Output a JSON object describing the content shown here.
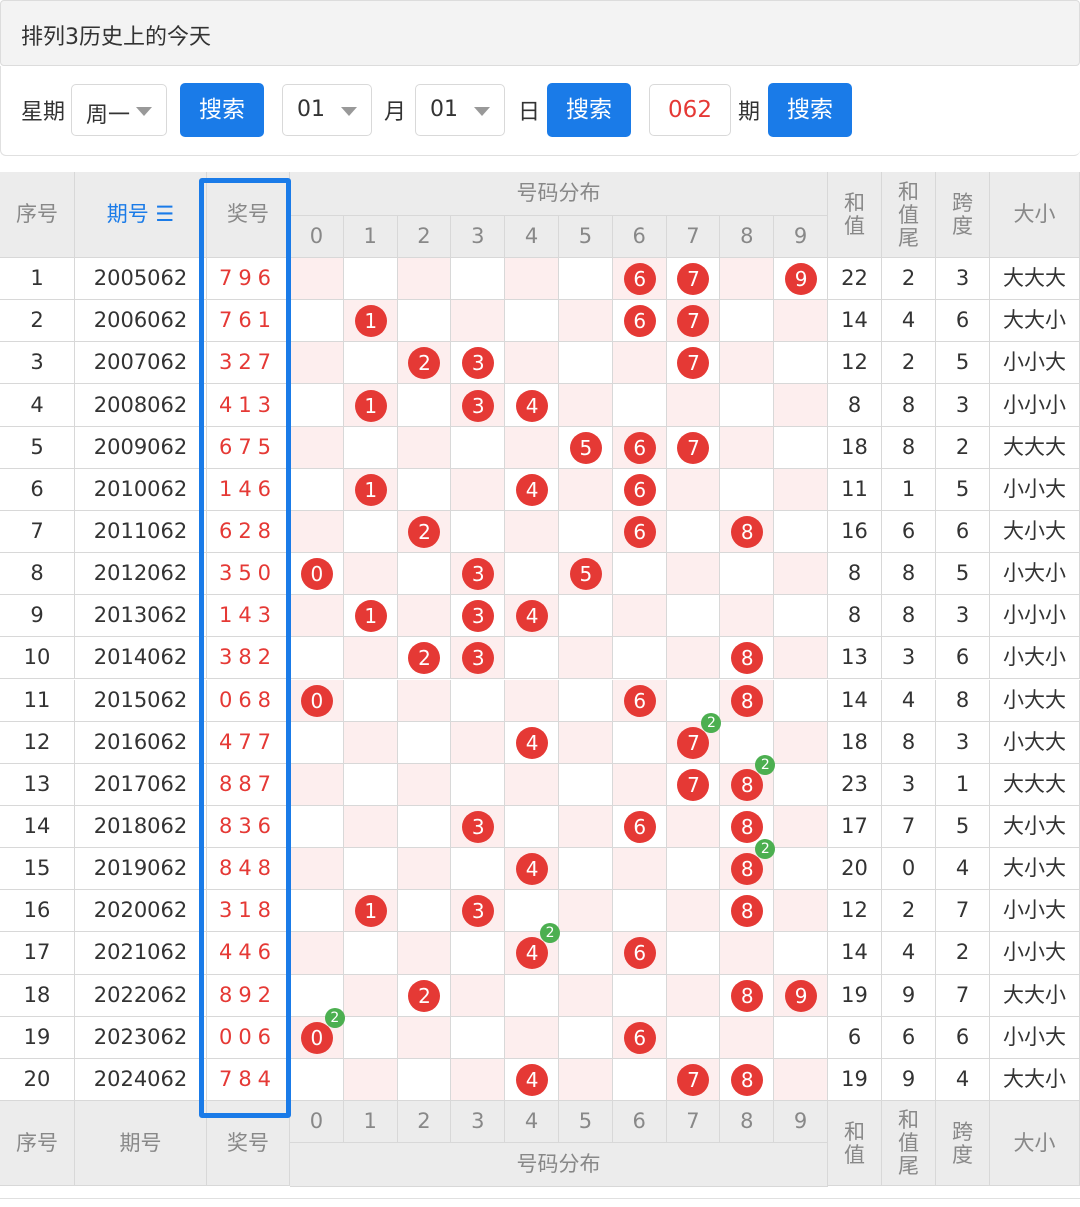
{
  "title": "排列3历史上的今天",
  "search": {
    "week_label": "星期",
    "week_value": "周一",
    "month_value": "01",
    "month_label": "月",
    "day_value": "01",
    "day_label": "日",
    "period_value": "062",
    "period_label": "期",
    "search_button": "搜索"
  },
  "table": {
    "headers": {
      "index": "序号",
      "period": "期号",
      "award": "奖号",
      "distribution": "号码分布",
      "sum": "和值",
      "sum_tail": "和值尾",
      "span": "跨度",
      "size": "大小"
    },
    "digits": [
      "0",
      "1",
      "2",
      "3",
      "4",
      "5",
      "6",
      "7",
      "8",
      "9"
    ],
    "rows": [
      {
        "idx": "1",
        "period": "2005062",
        "award": "796",
        "nums": [
          7,
          9,
          6
        ],
        "dup": null,
        "sum": "22",
        "tail": "2",
        "span": "3",
        "size": "大大大"
      },
      {
        "idx": "2",
        "period": "2006062",
        "award": "761",
        "nums": [
          7,
          6,
          1
        ],
        "dup": null,
        "sum": "14",
        "tail": "4",
        "span": "6",
        "size": "大大小"
      },
      {
        "idx": "3",
        "period": "2007062",
        "award": "327",
        "nums": [
          3,
          2,
          7
        ],
        "dup": null,
        "sum": "12",
        "tail": "2",
        "span": "5",
        "size": "小小大"
      },
      {
        "idx": "4",
        "period": "2008062",
        "award": "413",
        "nums": [
          4,
          1,
          3
        ],
        "dup": null,
        "sum": "8",
        "tail": "8",
        "span": "3",
        "size": "小小小"
      },
      {
        "idx": "5",
        "period": "2009062",
        "award": "675",
        "nums": [
          6,
          7,
          5
        ],
        "dup": null,
        "sum": "18",
        "tail": "8",
        "span": "2",
        "size": "大大大"
      },
      {
        "idx": "6",
        "period": "2010062",
        "award": "146",
        "nums": [
          1,
          4,
          6
        ],
        "dup": null,
        "sum": "11",
        "tail": "1",
        "span": "5",
        "size": "小小大"
      },
      {
        "idx": "7",
        "period": "2011062",
        "award": "628",
        "nums": [
          6,
          2,
          8
        ],
        "dup": null,
        "sum": "16",
        "tail": "6",
        "span": "6",
        "size": "大小大"
      },
      {
        "idx": "8",
        "period": "2012062",
        "award": "350",
        "nums": [
          3,
          5,
          0
        ],
        "dup": null,
        "sum": "8",
        "tail": "8",
        "span": "5",
        "size": "小大小"
      },
      {
        "idx": "9",
        "period": "2013062",
        "award": "143",
        "nums": [
          1,
          4,
          3
        ],
        "dup": null,
        "sum": "8",
        "tail": "8",
        "span": "3",
        "size": "小小小"
      },
      {
        "idx": "10",
        "period": "2014062",
        "award": "382",
        "nums": [
          3,
          8,
          2
        ],
        "dup": null,
        "sum": "13",
        "tail": "3",
        "span": "6",
        "size": "小大小"
      },
      {
        "idx": "11",
        "period": "2015062",
        "award": "068",
        "nums": [
          0,
          6,
          8
        ],
        "dup": null,
        "sum": "14",
        "tail": "4",
        "span": "8",
        "size": "小大大"
      },
      {
        "idx": "12",
        "period": "2016062",
        "award": "477",
        "nums": [
          4,
          7
        ],
        "dup": 7,
        "sum": "18",
        "tail": "8",
        "span": "3",
        "size": "小大大"
      },
      {
        "idx": "13",
        "period": "2017062",
        "award": "887",
        "nums": [
          8,
          7
        ],
        "dup": 8,
        "sum": "23",
        "tail": "3",
        "span": "1",
        "size": "大大大"
      },
      {
        "idx": "14",
        "period": "2018062",
        "award": "836",
        "nums": [
          8,
          3,
          6
        ],
        "dup": null,
        "sum": "17",
        "tail": "7",
        "span": "5",
        "size": "大小大"
      },
      {
        "idx": "15",
        "period": "2019062",
        "award": "848",
        "nums": [
          8,
          4
        ],
        "dup": 8,
        "sum": "20",
        "tail": "0",
        "span": "4",
        "size": "大小大"
      },
      {
        "idx": "16",
        "period": "2020062",
        "award": "318",
        "nums": [
          3,
          1,
          8
        ],
        "dup": null,
        "sum": "12",
        "tail": "2",
        "span": "7",
        "size": "小小大"
      },
      {
        "idx": "17",
        "period": "2021062",
        "award": "446",
        "nums": [
          4,
          6
        ],
        "dup": 4,
        "sum": "14",
        "tail": "4",
        "span": "2",
        "size": "小小大"
      },
      {
        "idx": "18",
        "period": "2022062",
        "award": "892",
        "nums": [
          8,
          9,
          2
        ],
        "dup": null,
        "sum": "19",
        "tail": "9",
        "span": "7",
        "size": "大大小"
      },
      {
        "idx": "19",
        "period": "2023062",
        "award": "006",
        "nums": [
          0,
          6
        ],
        "dup": 0,
        "sum": "6",
        "tail": "6",
        "span": "6",
        "size": "小小大"
      },
      {
        "idx": "20",
        "period": "2024062",
        "award": "784",
        "nums": [
          7,
          8,
          4
        ],
        "dup": null,
        "sum": "19",
        "tail": "9",
        "span": "4",
        "size": "大大小"
      }
    ],
    "dup_badge": "2",
    "colors": {
      "ball": "#e53935",
      "badge": "#4caf50",
      "accent": "#1a7be8"
    }
  }
}
